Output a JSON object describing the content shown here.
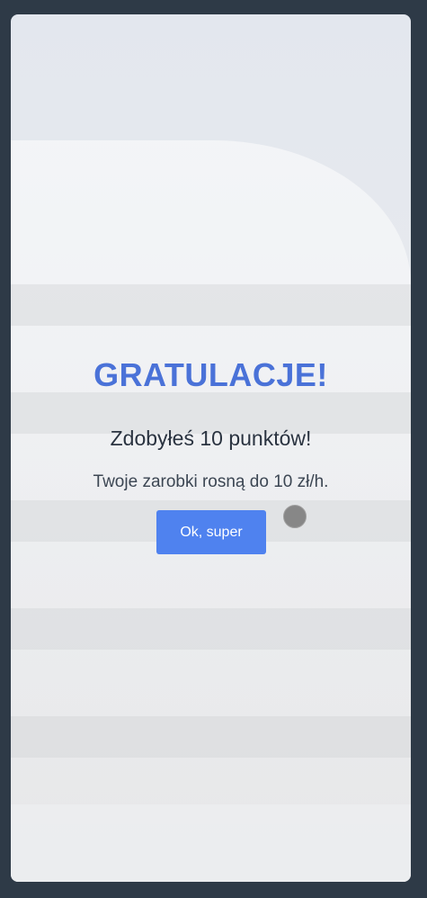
{
  "dialog": {
    "title": "GRATULACJE!",
    "subtitle": "Zdobyłeś 10 punktów!",
    "message": "Twoje zarobki rosną do 10 zł/h.",
    "ok_label": "Ok, super"
  },
  "colors": {
    "page_background": "#2e3a47",
    "title": "#4a72d8",
    "button": "#4f82ef",
    "cursor": "#878787"
  }
}
